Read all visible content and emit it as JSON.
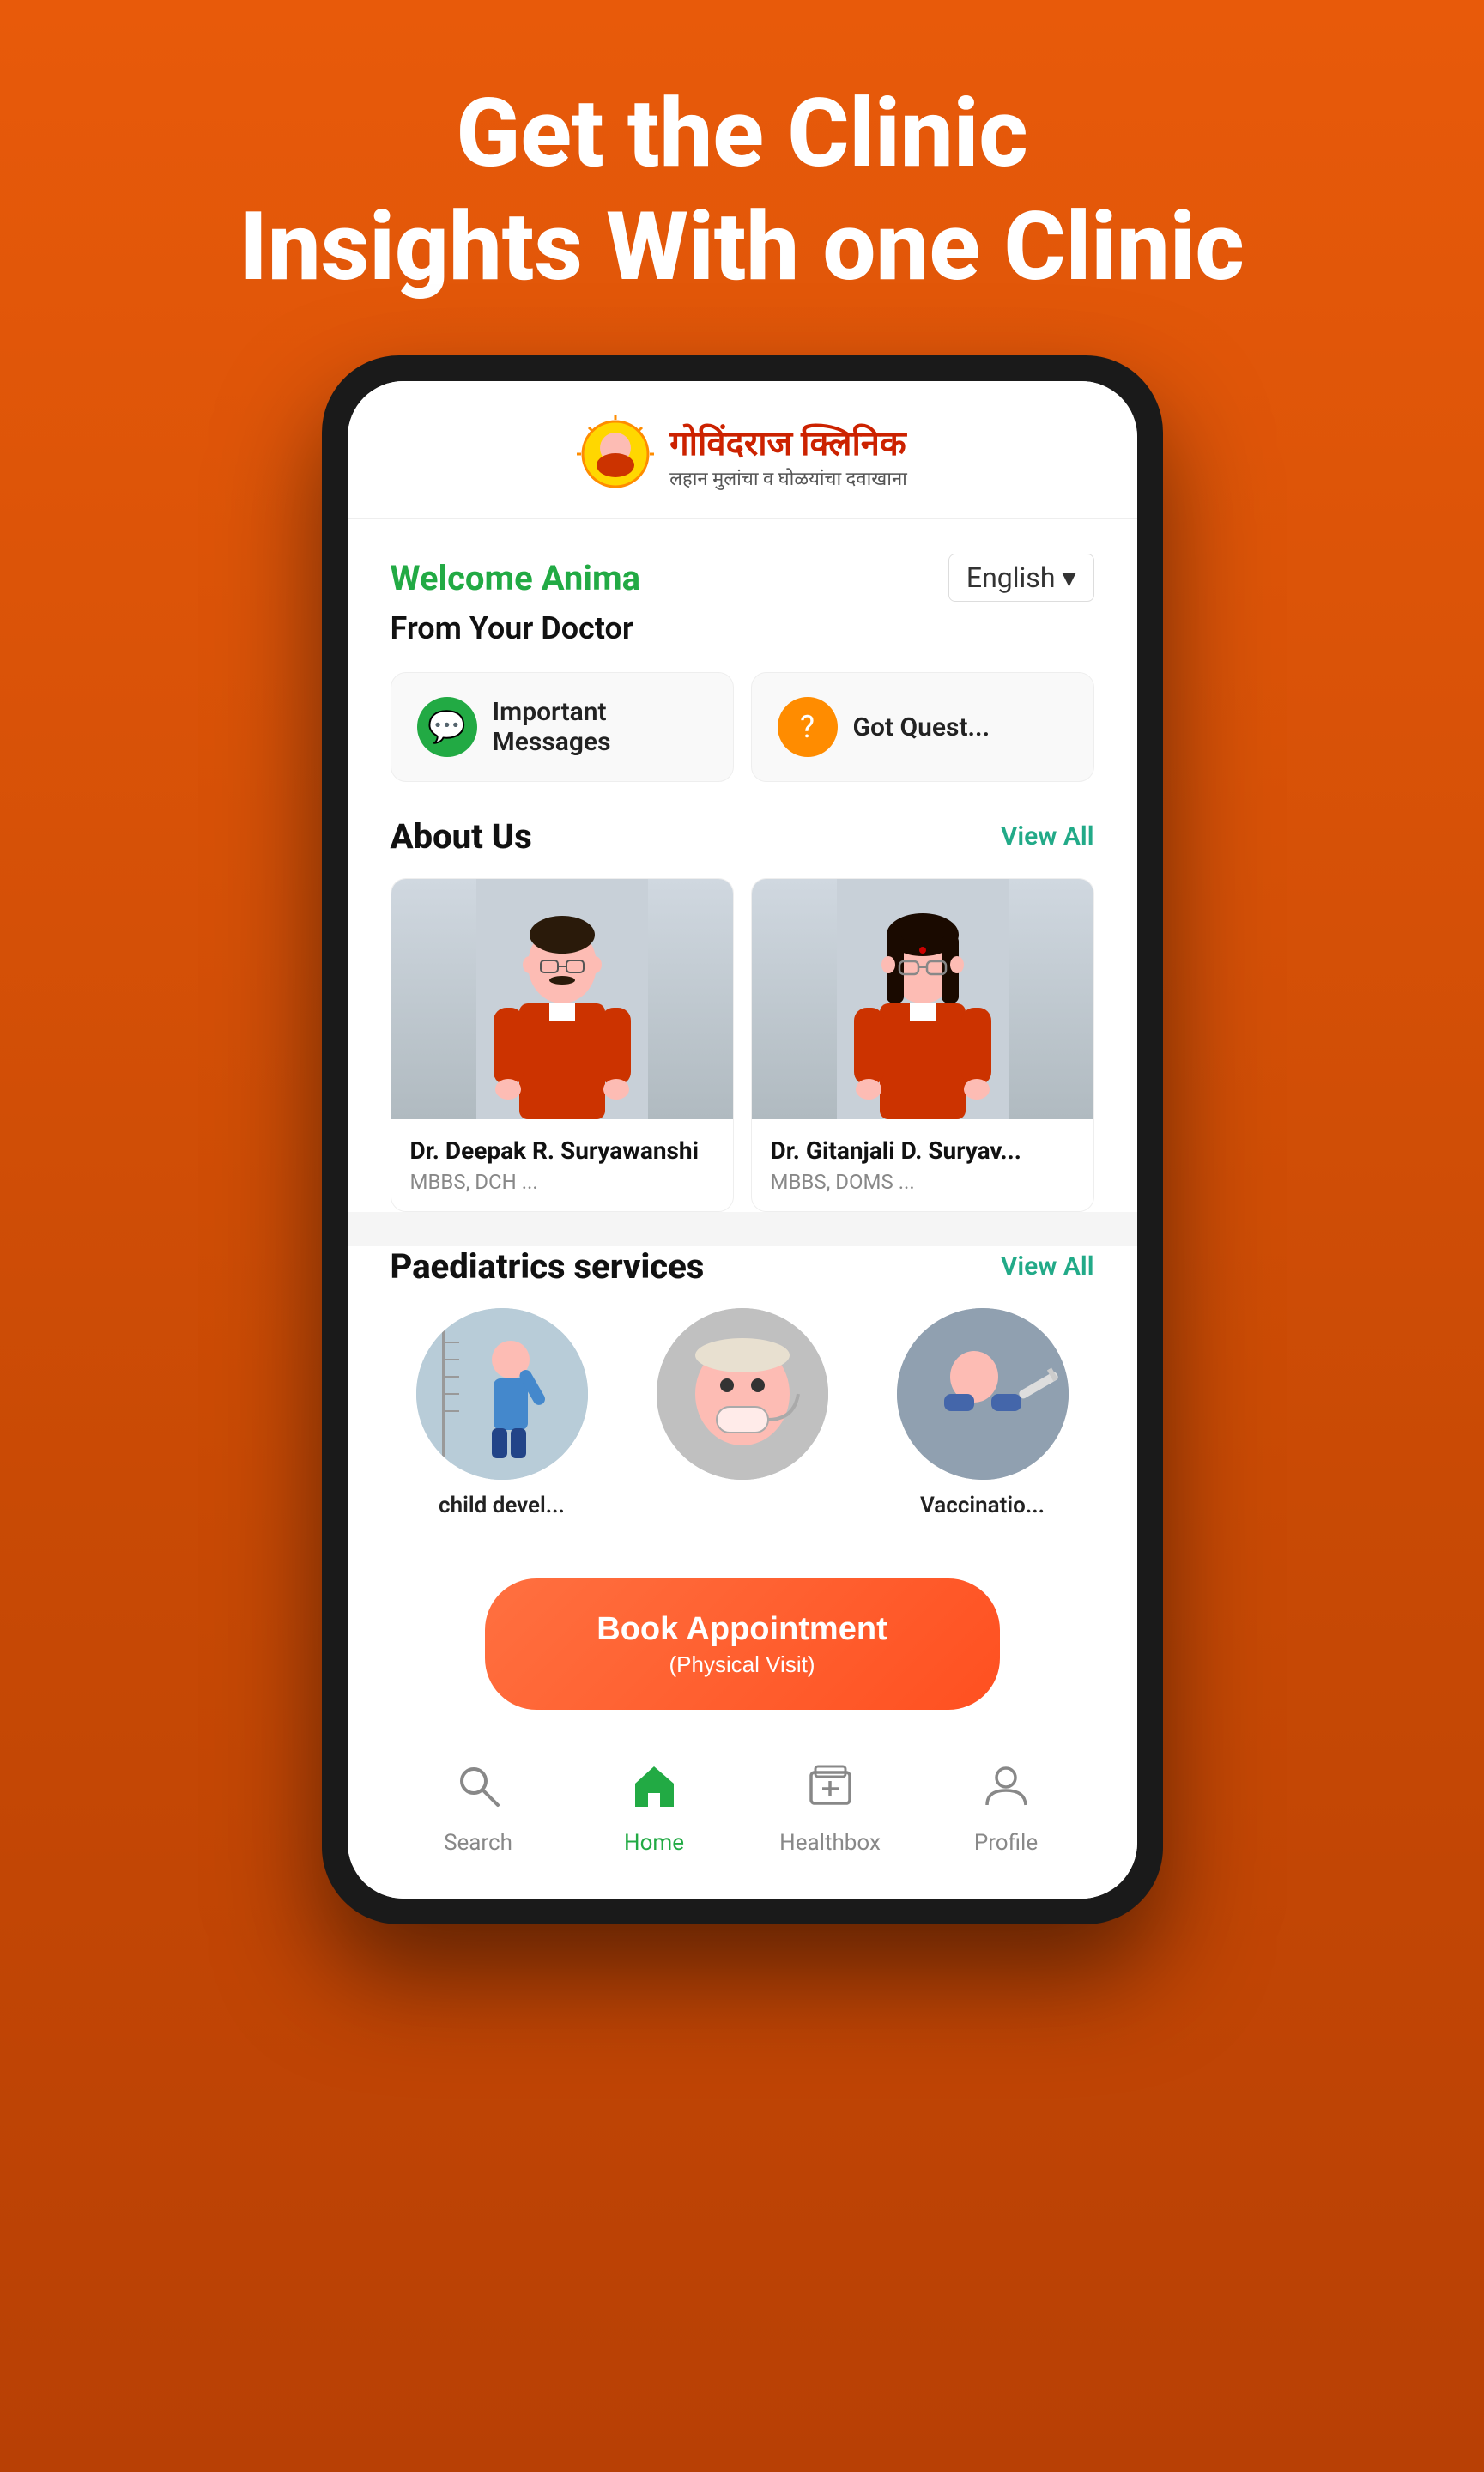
{
  "hero": {
    "line1": "Get the Clinic",
    "line2": "Insights With one Clinic"
  },
  "clinic": {
    "name_marathi": "गोविंदराज क्लिनिक",
    "subtitle": "लहान मुलांचा व घोळयांचा दवाखाना"
  },
  "app": {
    "welcome_text": "Welcome Anima",
    "language": "English",
    "from_doctor": "From Your Doctor",
    "messages": [
      {
        "label": "Important Messages",
        "icon_type": "green",
        "icon": "💬"
      },
      {
        "label": "Got Quest...",
        "icon_type": "orange",
        "icon": "?"
      }
    ],
    "about_section": {
      "title": "About Us",
      "view_all": "View All",
      "doctors": [
        {
          "name": "Dr. Deepak R. Suryawanshi",
          "quals": "MBBS, DCH ..."
        },
        {
          "name": "Dr. Gitanjali D. Suryav...",
          "quals": "MBBS, DOMS ..."
        }
      ]
    },
    "paed_section": {
      "title": "Paediatrics services",
      "view_all": "View All",
      "services": [
        {
          "label": "child devel..."
        },
        {
          "label": ""
        },
        {
          "label": "Vaccinatio..."
        }
      ]
    },
    "book_btn": {
      "main": "Book Appointment",
      "sub": "(Physical Visit)"
    },
    "bottom_nav": [
      {
        "label": "Search",
        "icon": "🔍",
        "active": false
      },
      {
        "label": "Home",
        "icon": "🏠",
        "active": true
      },
      {
        "label": "Healthbox",
        "icon": "🧰",
        "active": false
      },
      {
        "label": "Profile",
        "icon": "👤",
        "active": false
      }
    ]
  }
}
